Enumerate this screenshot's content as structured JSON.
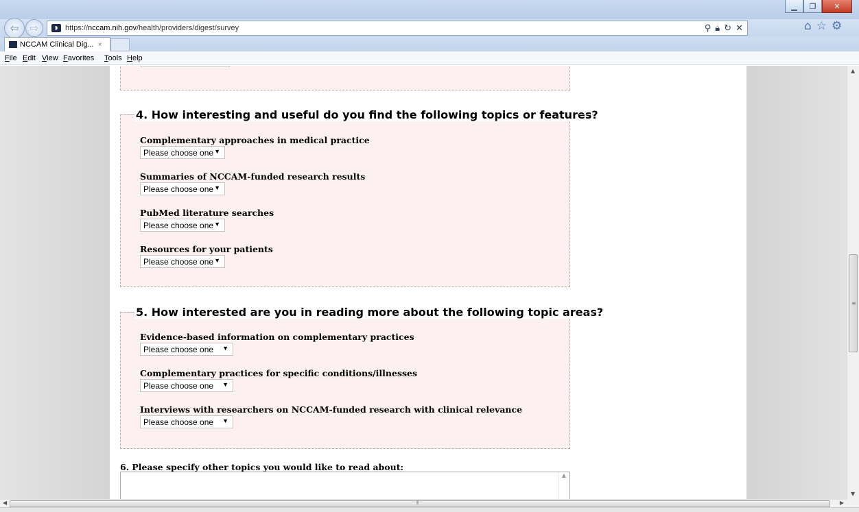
{
  "browser": {
    "url_prefix": "https://",
    "url_host": "nccam.nih.gov",
    "url_path": "/health/providers/digest/survey",
    "tab_title": "NCCAM Clinical Dig...",
    "tab_close": "×",
    "menu": [
      "File",
      "Edit",
      "View",
      "Favorites",
      "Tools",
      "Help"
    ]
  },
  "survey": {
    "q4": {
      "title": "4. How interesting and useful do you find the following topics or features?",
      "items": [
        {
          "label": "Complementary approaches in medical practice",
          "value": "Please choose one"
        },
        {
          "label": "Summaries of NCCAM-funded research results",
          "value": "Please choose one"
        },
        {
          "label": "PubMed literature searches",
          "value": "Please choose one"
        },
        {
          "label": "Resources for your patients",
          "value": "Please choose one"
        }
      ]
    },
    "q5": {
      "title": "5. How interested are you in reading more about the following topic areas?",
      "items": [
        {
          "label": "Evidence-based information on complementary practices",
          "value": "Please choose one"
        },
        {
          "label": "Complementary practices for specific conditions/illnesses",
          "value": "Please choose one"
        },
        {
          "label": "Interviews with researchers on NCCAM-funded research with clinical relevance",
          "value": "Please choose one"
        }
      ]
    },
    "q6": {
      "title": "6. Please specify other topics you would like to read about:",
      "value": ""
    }
  }
}
